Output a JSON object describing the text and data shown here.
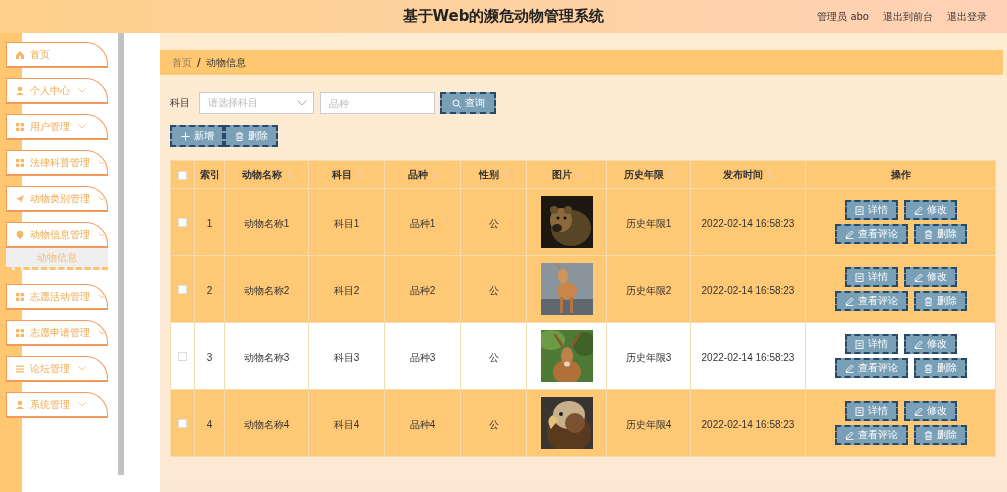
{
  "header": {
    "title": "基于Web的濒危动物管理系统",
    "links": [
      "管理员 abo",
      "退出到前台",
      "退出登录"
    ]
  },
  "sidebar": {
    "items": [
      {
        "label": "首页",
        "has_submenu": false
      },
      {
        "label": "个人中心",
        "has_submenu": true
      },
      {
        "label": "用户管理",
        "has_submenu": true
      },
      {
        "label": "法律科普管理",
        "has_submenu": true
      },
      {
        "label": "动物类别管理",
        "has_submenu": true
      },
      {
        "label": "动物信息管理",
        "has_submenu": true,
        "children": [
          {
            "label": "动物信息",
            "selected": true
          }
        ]
      },
      {
        "label": "志愿活动管理",
        "has_submenu": true
      },
      {
        "label": "志愿申请管理",
        "has_submenu": true
      },
      {
        "label": "论坛管理",
        "has_submenu": true
      },
      {
        "label": "系统管理",
        "has_submenu": true
      }
    ]
  },
  "breadcrumb": {
    "items": [
      "首页",
      "动物信息"
    ],
    "separator": "/"
  },
  "search": {
    "label": "科目",
    "select_placeholder": "请选择科目",
    "input_placeholder": "品种",
    "button": "查询"
  },
  "actions": [
    "新增",
    "删除"
  ],
  "table": {
    "select_all_checked": false,
    "columns": [
      {
        "label": "索引",
        "kind": "text",
        "sortable": false
      },
      {
        "label": "动物名称",
        "kind": "text",
        "sortable": true
      },
      {
        "label": "科目",
        "kind": "text",
        "sortable": true
      },
      {
        "label": "品种",
        "kind": "text",
        "sortable": true
      },
      {
        "label": "性别",
        "kind": "text",
        "sortable": true
      },
      {
        "label": "图片",
        "kind": "picture",
        "sortable": true
      },
      {
        "label": "历史年限",
        "kind": "text",
        "sortable": true
      },
      {
        "label": "发布时间",
        "kind": "text",
        "sortable": true
      },
      {
        "label": "操作",
        "kind": "actions",
        "sortable": false
      }
    ],
    "rows": [
      {
        "checked": false,
        "highlighted": true,
        "cells": [
          "1",
          "动物名称1",
          "科目1",
          "品种1",
          "公",
          "",
          "历史年限1",
          "2022-02-14 16:58:23"
        ],
        "actions": [
          "详情",
          "修改",
          "查看评论",
          "删除"
        ]
      },
      {
        "checked": false,
        "highlighted": true,
        "cells": [
          "2",
          "动物名称2",
          "科目2",
          "品种2",
          "公",
          "",
          "历史年限2",
          "2022-02-14 16:58:23"
        ],
        "actions": [
          "详情",
          "修改",
          "查看评论",
          "删除"
        ]
      },
      {
        "checked": false,
        "highlighted": false,
        "cells": [
          "3",
          "动物名称3",
          "科目3",
          "品种3",
          "公",
          "",
          "历史年限3",
          "2022-02-14 16:58:23"
        ],
        "actions": [
          "详情",
          "修改",
          "查看评论",
          "删除"
        ]
      },
      {
        "checked": false,
        "highlighted": true,
        "cells": [
          "4",
          "动物名称4",
          "科目4",
          "品种4",
          "公",
          "",
          "历史年限4",
          "2022-02-14 16:58:23"
        ],
        "actions": [
          "详情",
          "修改",
          "查看评论",
          "删除"
        ]
      }
    ]
  }
}
